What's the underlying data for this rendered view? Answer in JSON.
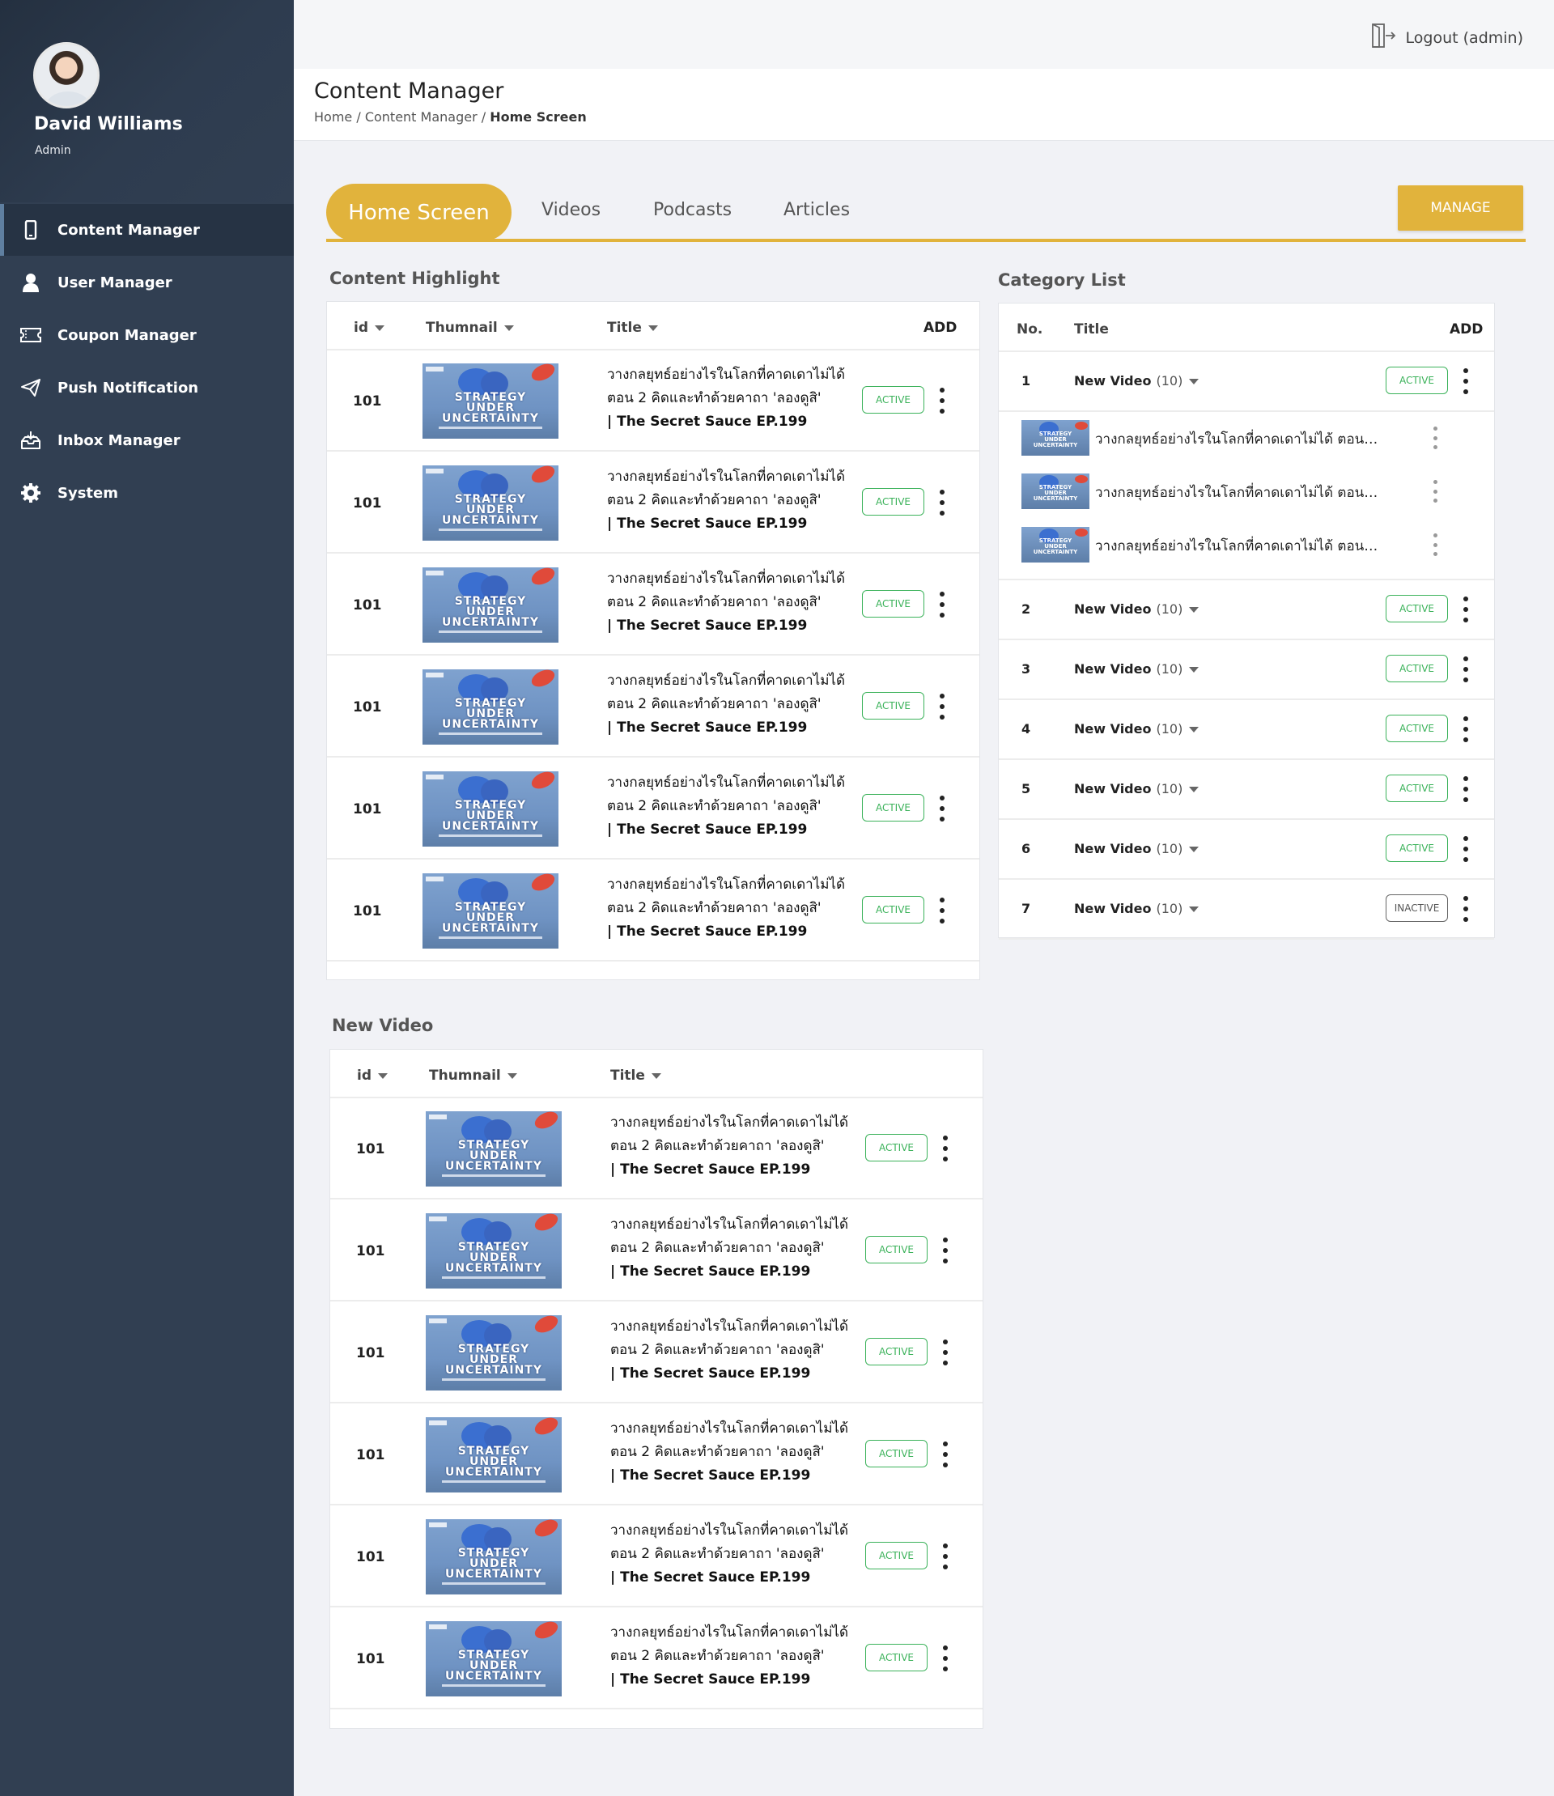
{
  "user": {
    "name": "David Williams",
    "role": "Admin"
  },
  "nav": [
    {
      "label": "Content Manager",
      "icon": "phone-icon",
      "active": true
    },
    {
      "label": "User Manager",
      "icon": "user-icon"
    },
    {
      "label": "Coupon Manager",
      "icon": "ticket-icon"
    },
    {
      "label": "Push Notification",
      "icon": "paper-plane-icon"
    },
    {
      "label": "Inbox Manager",
      "icon": "inbox-icon"
    },
    {
      "label": "System",
      "icon": "gear-icon"
    }
  ],
  "topbar": {
    "logout_label": "Logout (admin)"
  },
  "header": {
    "title": "Content Manager",
    "breadcrumb": {
      "home": "Home",
      "section": "Content Manager",
      "current": "Home Screen"
    }
  },
  "tabs": [
    "Home Screen",
    "Videos",
    "Podcasts",
    "Articles"
  ],
  "manage_label": "MANAGE",
  "content_highlight": {
    "title": "Content Highlight",
    "columns": {
      "id": "id",
      "thumb": "Thumnail",
      "title": "Title",
      "add": "ADD"
    },
    "rows": [
      {
        "id": "101",
        "line1": "วางกลยุทธ์อย่างไรในโลกที่คาดเดาไม่ได้",
        "line2": "ตอน 2 คิดและทำด้วยคาถา 'ลองดูสิ'",
        "line3": "| The Secret Sauce EP.199",
        "status": "ACTIVE"
      },
      {
        "id": "101",
        "line1": "วางกลยุทธ์อย่างไรในโลกที่คาดเดาไม่ได้",
        "line2": "ตอน 2 คิดและทำด้วยคาถา 'ลองดูสิ'",
        "line3": "| The Secret Sauce EP.199",
        "status": "ACTIVE"
      },
      {
        "id": "101",
        "line1": "วางกลยุทธ์อย่างไรในโลกที่คาดเดาไม่ได้",
        "line2": "ตอน 2 คิดและทำด้วยคาถา 'ลองดูสิ'",
        "line3": "| The Secret Sauce EP.199",
        "status": "ACTIVE"
      },
      {
        "id": "101",
        "line1": "วางกลยุทธ์อย่างไรในโลกที่คาดเดาไม่ได้",
        "line2": "ตอน 2 คิดและทำด้วยคาถา 'ลองดูสิ'",
        "line3": "| The Secret Sauce EP.199",
        "status": "ACTIVE"
      },
      {
        "id": "101",
        "line1": "วางกลยุทธ์อย่างไรในโลกที่คาดเดาไม่ได้",
        "line2": "ตอน 2 คิดและทำด้วยคาถา 'ลองดูสิ'",
        "line3": "| The Secret Sauce EP.199",
        "status": "ACTIVE"
      },
      {
        "id": "101",
        "line1": "วางกลยุทธ์อย่างไรในโลกที่คาดเดาไม่ได้",
        "line2": "ตอน 2 คิดและทำด้วยคาถา 'ลองดูสิ'",
        "line3": "| The Secret Sauce EP.199",
        "status": "ACTIVE"
      }
    ]
  },
  "thumbnail_text": {
    "line1": "STRATEGY",
    "line2": "UNDER",
    "line3": "UNCERTAINTY"
  },
  "category_list": {
    "title": "Category List",
    "columns": {
      "no": "No.",
      "title": "Title",
      "add": "ADD"
    },
    "rows": [
      {
        "no": "1",
        "title": "New Video",
        "count": "(10)",
        "status": "ACTIVE"
      },
      {
        "no": "2",
        "title": "New Video",
        "count": "(10)",
        "status": "ACTIVE"
      },
      {
        "no": "3",
        "title": "New Video",
        "count": "(10)",
        "status": "ACTIVE"
      },
      {
        "no": "4",
        "title": "New Video",
        "count": "(10)",
        "status": "ACTIVE"
      },
      {
        "no": "5",
        "title": "New Video",
        "count": "(10)",
        "status": "ACTIVE"
      },
      {
        "no": "6",
        "title": "New Video",
        "count": "(10)",
        "status": "ACTIVE"
      },
      {
        "no": "7",
        "title": "New Video",
        "count": "(10)",
        "status": "INACTIVE"
      }
    ],
    "expanded_items": [
      "วางกลยุทธ์อย่างไรในโลกที่คาดเดาไม่ได้ ตอน 2...",
      "วางกลยุทธ์อย่างไรในโลกที่คาดเดาไม่ได้ ตอน 2...",
      "วางกลยุทธ์อย่างไรในโลกที่คาดเดาไม่ได้ ตอน 2..."
    ]
  },
  "new_video": {
    "title": "New Video",
    "columns": {
      "id": "id",
      "thumb": "Thumnail",
      "title": "Title"
    },
    "rows": [
      {
        "id": "101",
        "line1": "วางกลยุทธ์อย่างไรในโลกที่คาดเดาไม่ได้",
        "line2": "ตอน 2 คิดและทำด้วยคาถา 'ลองดูสิ'",
        "line3": "| The Secret Sauce EP.199",
        "status": "ACTIVE"
      },
      {
        "id": "101",
        "line1": "วางกลยุทธ์อย่างไรในโลกที่คาดเดาไม่ได้",
        "line2": "ตอน 2 คิดและทำด้วยคาถา 'ลองดูสิ'",
        "line3": "| The Secret Sauce EP.199",
        "status": "ACTIVE"
      },
      {
        "id": "101",
        "line1": "วางกลยุทธ์อย่างไรในโลกที่คาดเดาไม่ได้",
        "line2": "ตอน 2 คิดและทำด้วยคาถา 'ลองดูสิ'",
        "line3": "| The Secret Sauce EP.199",
        "status": "ACTIVE"
      },
      {
        "id": "101",
        "line1": "วางกลยุทธ์อย่างไรในโลกที่คาดเดาไม่ได้",
        "line2": "ตอน 2 คิดและทำด้วยคาถา 'ลองดูสิ'",
        "line3": "| The Secret Sauce EP.199",
        "status": "ACTIVE"
      },
      {
        "id": "101",
        "line1": "วางกลยุทธ์อย่างไรในโลกที่คาดเดาไม่ได้",
        "line2": "ตอน 2 คิดและทำด้วยคาถา 'ลองดูสิ'",
        "line3": "| The Secret Sauce EP.199",
        "status": "ACTIVE"
      },
      {
        "id": "101",
        "line1": "วางกลยุทธ์อย่างไรในโลกที่คาดเดาไม่ได้",
        "line2": "ตอน 2 คิดและทำด้วยคาถา 'ลองดูสิ'",
        "line3": "| The Secret Sauce EP.199",
        "status": "ACTIVE"
      }
    ]
  },
  "colors": {
    "accent": "#e1b33c",
    "sidebar": "#313f52",
    "active_green": "#3bb25a"
  }
}
